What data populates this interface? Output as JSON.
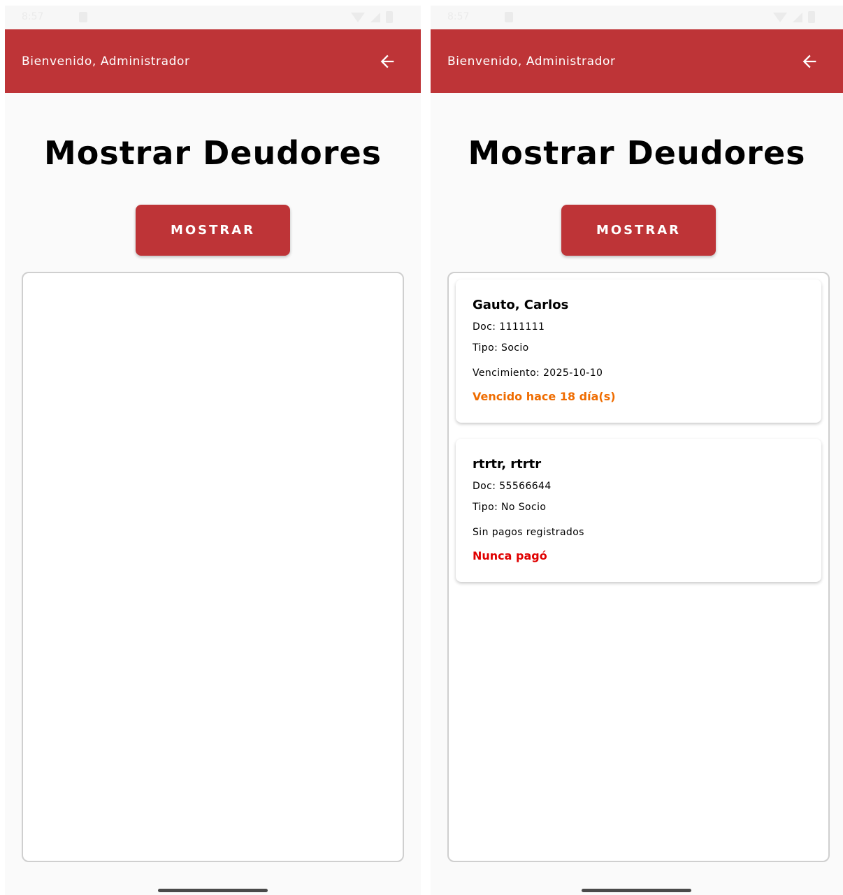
{
  "colors": {
    "primary": "#be3437",
    "overdue": "#ef6c00",
    "never_paid": "#e00000"
  },
  "status_bar": {
    "time": "8:57",
    "sd_icon": "sd-card-icon",
    "wifi_icon": "wifi-icon",
    "signal_icon": "signal-icon",
    "battery_icon": "battery-icon"
  },
  "screens": [
    {
      "app_bar": {
        "title": "Bienvenido, Administrador",
        "back_icon": "arrow-left-icon"
      },
      "page_title": "Mostrar Deudores",
      "show_button_label": "MOSTRAR",
      "debtors": []
    },
    {
      "app_bar": {
        "title": "Bienvenido, Administrador",
        "back_icon": "arrow-left-icon"
      },
      "page_title": "Mostrar Deudores",
      "show_button_label": "MOSTRAR",
      "debtors": [
        {
          "name": "Gauto, Carlos",
          "doc": "Doc: 1111111",
          "type": "Tipo: Socio",
          "due": "Vencimiento: 2025-10-10",
          "status": "Vencido hace 18 día(s)",
          "status_kind": "overdue"
        },
        {
          "name": "rtrtr, rtrtr",
          "doc": "Doc: 55566644",
          "type": "Tipo: No Socio",
          "due": "Sin pagos registrados",
          "status": "Nunca pagó",
          "status_kind": "never_paid"
        }
      ]
    }
  ]
}
